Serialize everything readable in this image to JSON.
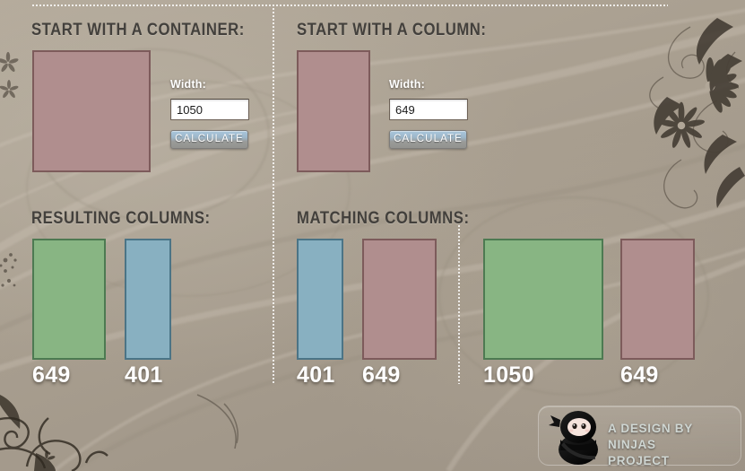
{
  "sections": {
    "container": {
      "heading": "START WITH A CONTAINER:",
      "width_label": "Width:",
      "width_value": "1050",
      "calculate_label": "CALCULATE"
    },
    "column": {
      "heading": "START WITH A COLUMN:",
      "width_label": "Width:",
      "width_value": "649",
      "calculate_label": "CALCULATE"
    },
    "resulting": {
      "heading": "RESULTING COLUMNS:",
      "columns": [
        {
          "value": "649",
          "color": "green"
        },
        {
          "value": "401",
          "color": "blue"
        }
      ]
    },
    "matching": {
      "heading": "MATCHING COLUMNS:",
      "group_a": [
        {
          "value": "401",
          "color": "blue"
        },
        {
          "value": "649",
          "color": "pink"
        }
      ],
      "group_b": [
        {
          "value": "1050",
          "color": "green"
        },
        {
          "value": "649",
          "color": "pink"
        }
      ]
    }
  },
  "footer": {
    "line1": "A DESIGN BY NINJAS",
    "line2": "PROJECT"
  },
  "colors": {
    "pink": "#b08e8e",
    "pink_border": "#7d5b5b",
    "green": "#88b583",
    "green_border": "#4d7a52",
    "blue": "#88b0c1",
    "blue_border": "#4b7486",
    "background": "#a89e90",
    "heading_text": "#43403c",
    "number_text": "#ffffff",
    "button_top": "#a9c6dc",
    "button_bottom": "#93938f"
  }
}
